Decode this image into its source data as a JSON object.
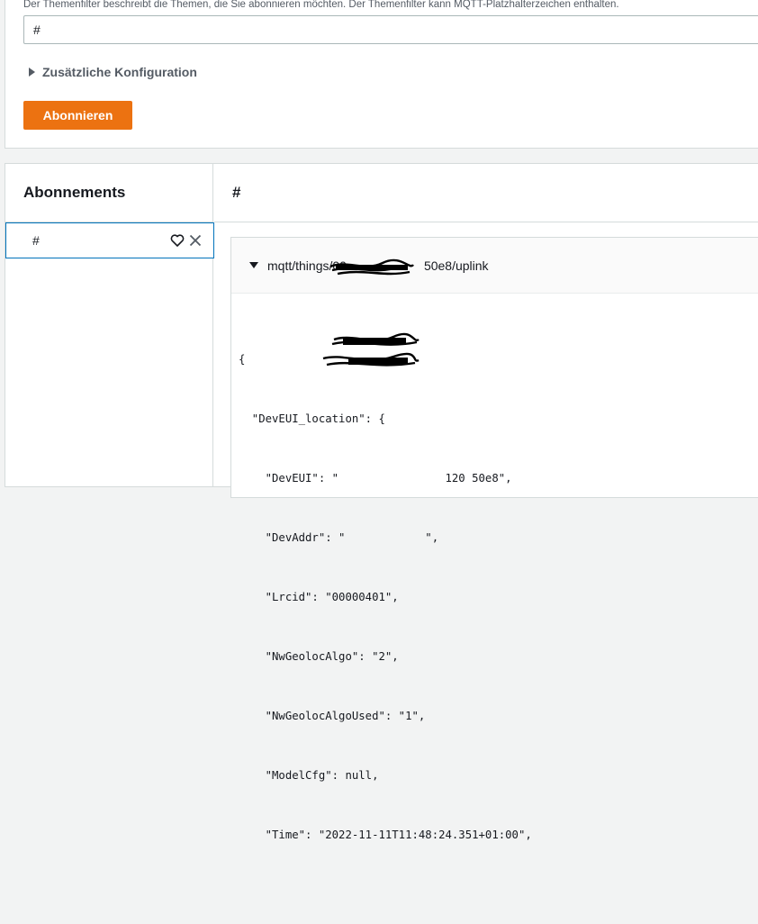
{
  "subscribe_form": {
    "hint": "Der Themenfilter beschreibt die Themen, die Sie abonnieren möchten. Der Themenfilter kann MQTT-Platzhalterzeichen enthalten.",
    "topic_value": "#",
    "additional_config_label": "Zusätzliche Konfiguration",
    "subscribe_button": "Abonnieren"
  },
  "subscriptions": {
    "heading": "Abonnements",
    "items": [
      {
        "topic": "#"
      }
    ]
  },
  "messages": {
    "heading": "#",
    "message": {
      "topic_prefix": "mqtt/things/00",
      "topic_suffix": "50e8/uplink",
      "json_lines": [
        "{",
        "  \"DevEUI_location\": {",
        "    \"DevEUI\": \"                120 50e8\",",
        "    \"DevAddr\": \"            \",",
        "    \"Lrcid\": \"00000401\",",
        "    \"NwGeolocAlgo\": \"2\",",
        "    \"NwGeolocAlgoUsed\": \"1\",",
        "    \"ModelCfg\": null,",
        "    \"Time\": \"2022-11-11T11:48:24.351+01:00\","
      ]
    }
  },
  "colors": {
    "accent": "#ec7211",
    "selected_border": "#0073bb",
    "border": "#d5dbdb"
  }
}
